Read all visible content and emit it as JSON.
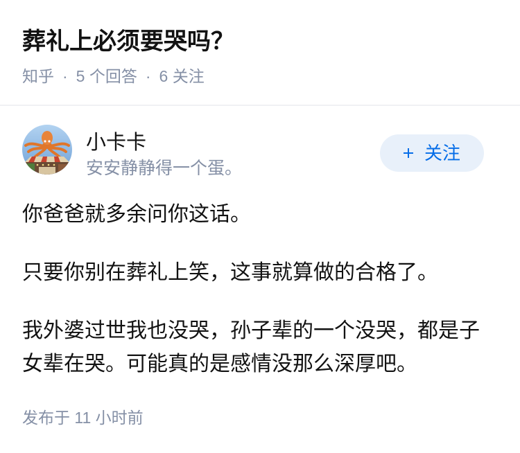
{
  "question": {
    "title": "葬礼上必须要哭吗？",
    "meta": {
      "site": "知乎",
      "separator": "·",
      "answers": "5 个回答",
      "follows": "6 关注"
    }
  },
  "answer": {
    "author": {
      "name": "小卡卡",
      "bio": "安安静静得一个蛋。"
    },
    "follow_button": {
      "icon": "plus-icon",
      "label": "关注"
    },
    "paragraphs": [
      "你爸爸就多余问你这话。",
      "只要你别在葬礼上笑，这事就算做的合格了。",
      "我外婆过世我也没哭，孙子辈的一个没哭，都是子女辈在哭。可能真的是感情没那么深厚吧。"
    ],
    "published": "发布于 11 小时前"
  },
  "colors": {
    "brand": "#056de8",
    "brand_bg": "#e8f0fa",
    "muted": "#8590a6",
    "text": "#121212"
  }
}
